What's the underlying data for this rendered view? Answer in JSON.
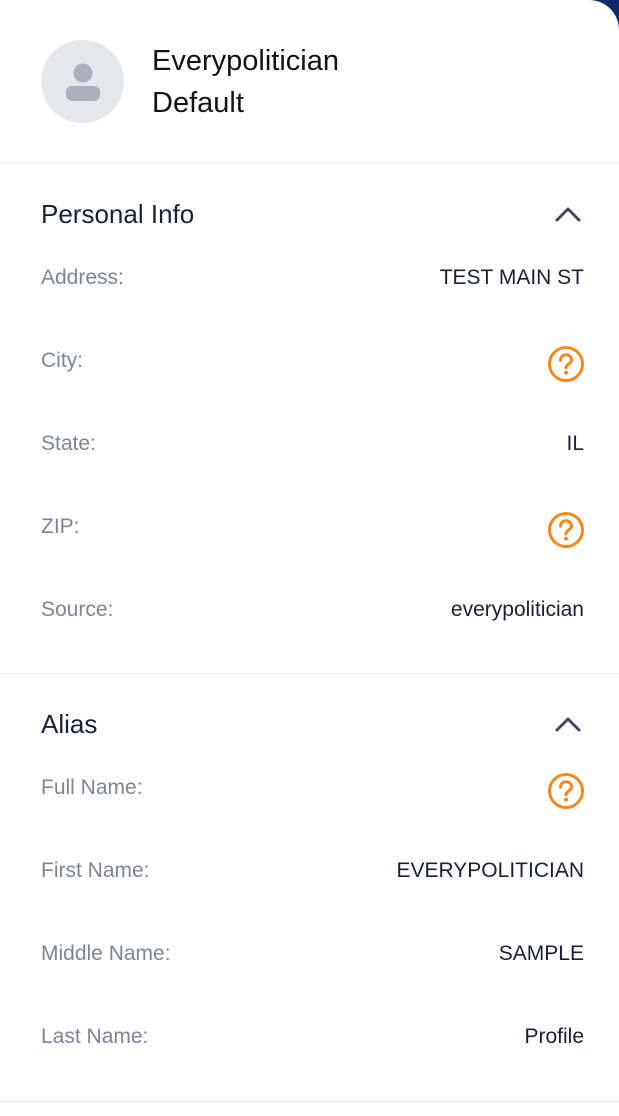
{
  "profile": {
    "name_line1": "Everypolitician",
    "name_line2": "Default"
  },
  "personal_info": {
    "title": "Personal Info",
    "rows": [
      {
        "label": "Address:",
        "value": "TEST MAIN ST"
      },
      {
        "label": "City:",
        "value": null,
        "icon": "question-circle-icon"
      },
      {
        "label": "State:",
        "value": "IL"
      },
      {
        "label": "ZIP:",
        "value": null,
        "icon": "question-circle-icon"
      },
      {
        "label": "Source:",
        "value": "everypolitician"
      }
    ]
  },
  "alias": {
    "title": "Alias",
    "rows": [
      {
        "label": "Full Name:",
        "value": null,
        "icon": "question-circle-icon"
      },
      {
        "label": "First Name:",
        "value": "EVERYPOLITICIAN"
      },
      {
        "label": "Middle Name:",
        "value": "SAMPLE"
      },
      {
        "label": "Last Name:",
        "value": "Profile"
      }
    ]
  },
  "colors": {
    "accent_orange": "#f5891f",
    "brand_navy": "#0d2a6b",
    "chevron": "#3e4a5c"
  },
  "icons": {
    "avatar": "person-icon",
    "section_toggle": "chevron-up-icon",
    "missing_value": "question-circle-icon"
  }
}
